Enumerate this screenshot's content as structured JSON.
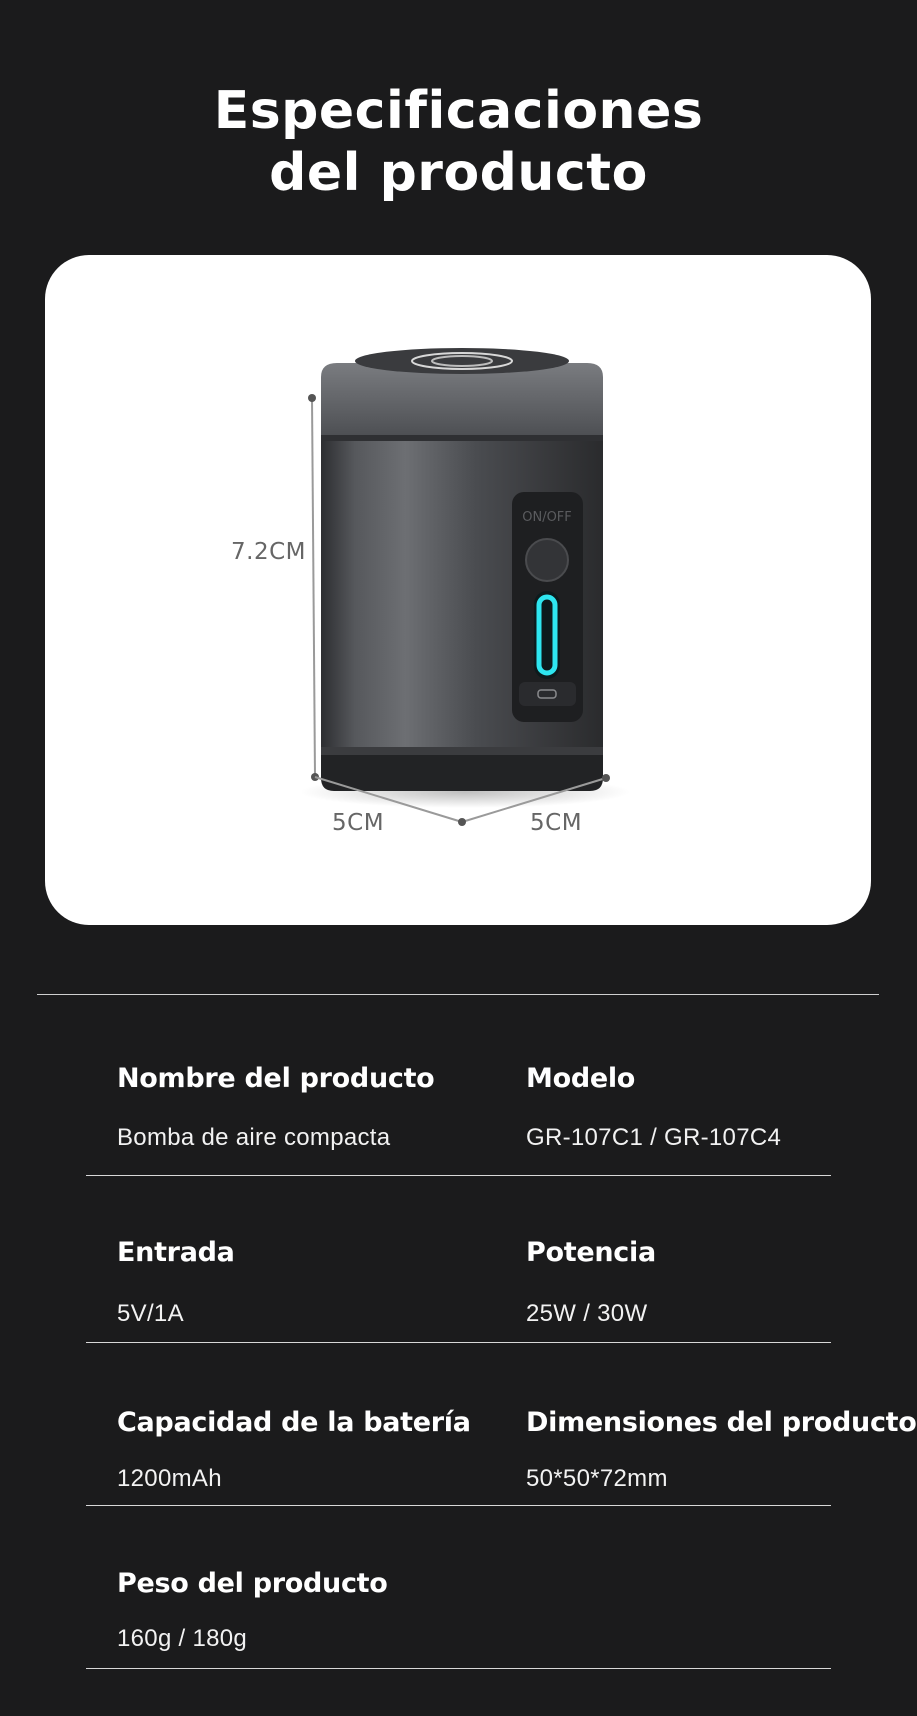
{
  "page": {
    "title_line1": "Especificaciones",
    "title_line2": "del producto"
  },
  "product_image": {
    "height_label": "7.2CM",
    "width_label_left": "5CM",
    "width_label_right": "5CM",
    "button_text": "ON/OFF",
    "indicator_color": "#2ee6f0"
  },
  "specs": [
    {
      "label": "Nombre del producto",
      "value": "Bomba de aire compacta"
    },
    {
      "label": "Modelo",
      "value": "GR-107C1 / GR-107C4"
    },
    {
      "label": "Entrada",
      "value": "5V/1A"
    },
    {
      "label": "Potencia",
      "value": "25W / 30W"
    },
    {
      "label": "Capacidad de la batería",
      "value": "1200mAh"
    },
    {
      "label": "Dimensiones del producto",
      "value": "50*50*72mm"
    },
    {
      "label": "Peso del producto",
      "value": "160g / 180g"
    }
  ],
  "colors": {
    "background": "#1b1b1c",
    "card": "#ffffff",
    "text": "#ffffff"
  }
}
